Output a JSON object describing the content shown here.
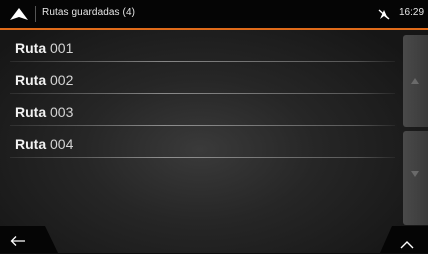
{
  "header": {
    "title": "Rutas guardadas (4)",
    "time": "16:29",
    "nav_icon": "navigation-arrow-icon",
    "status_icon": "gps-off-icon"
  },
  "routes": [
    {
      "bold": "Ruta",
      "number": "001"
    },
    {
      "bold": "Ruta",
      "number": "002"
    },
    {
      "bold": "Ruta",
      "number": "003"
    },
    {
      "bold": "Ruta",
      "number": "004"
    }
  ],
  "scroll": {
    "up_icon": "scroll-up-icon",
    "down_icon": "scroll-down-icon"
  },
  "footer": {
    "back_icon": "back-arrow-icon",
    "more_icon": "chevron-up-icon"
  },
  "colors": {
    "accent": "#e06b1a",
    "background": "#262626",
    "header": "#050505"
  }
}
